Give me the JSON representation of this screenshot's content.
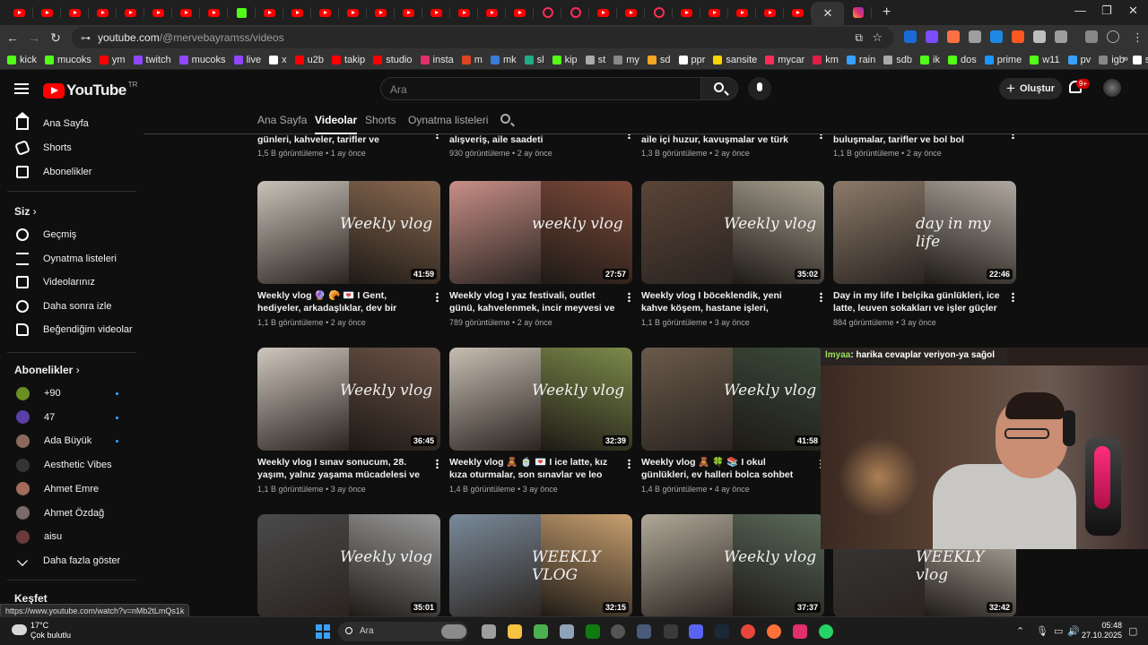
{
  "browser": {
    "url_host": "youtube.com",
    "url_path": "/@mervebayramss/videos",
    "new_tab": "+",
    "window_min": "—",
    "window_max": "❐",
    "window_close": "✕",
    "status_url": "https://www.youtube.com/watch?v=nMb2tLmQs1k",
    "bookmarks": [
      "kick",
      "mucoks",
      "ym",
      "twitch",
      "mucoks",
      "live",
      "x",
      "u2b",
      "takip",
      "studio",
      "insta",
      "m",
      "mk",
      "sl",
      "kip",
      "st",
      "my",
      "sd",
      "ppr",
      "sansite",
      "mycar",
      "km",
      "rain",
      "sdb",
      "ik",
      "dos",
      "prime",
      "w11",
      "pv",
      "igb",
      "steam"
    ],
    "bookmark_colors": [
      "#53fc18",
      "#53fc18",
      "#ff0000",
      "#9146ff",
      "#9146ff",
      "#9146ff",
      "#ffffff",
      "#ff0000",
      "#ff0000",
      "#ff0000",
      "#e1306c",
      "#dd4422",
      "#3a7bd5",
      "#22aa88",
      "#53fc18",
      "#aaaaaa",
      "#888888",
      "#f5a623",
      "#ffffff",
      "#ffd400",
      "#ff2d55",
      "#e11d48",
      "#3aa0ff",
      "#aaaaaa",
      "#53fc18",
      "#53fc18",
      "#1a98ff",
      "#53fc18",
      "#3aa0ff",
      "#888888",
      "#ffffff"
    ],
    "bookmarks_more": "»"
  },
  "header": {
    "logo": "YouTube",
    "region": "TR",
    "search_placeholder": "Ara",
    "create_label": "Oluştur",
    "notif_count": "9+"
  },
  "sidebar": {
    "main": [
      {
        "label": "Ana Sayfa",
        "icon": "home-icon"
      },
      {
        "label": "Shorts",
        "icon": "shorts-icon"
      },
      {
        "label": "Abonelikler",
        "icon": "subscriptions-icon"
      }
    ],
    "you_header": "Siz",
    "you": [
      {
        "label": "Geçmiş",
        "icon": "history-icon"
      },
      {
        "label": "Oynatma listeleri",
        "icon": "playlists-icon"
      },
      {
        "label": "Videolarınız",
        "icon": "your-videos-icon"
      },
      {
        "label": "Daha sonra izle",
        "icon": "watch-later-icon"
      },
      {
        "label": "Beğendiğim videolar",
        "icon": "liked-videos-icon"
      }
    ],
    "subs_header": "Abonelikler",
    "subs": [
      {
        "label": "+90",
        "color": "#6b8e23",
        "dot": true
      },
      {
        "label": "47",
        "color": "#5b3fa8",
        "dot": true
      },
      {
        "label": "Ada Büyük",
        "color": "#8a6a5a",
        "dot": true
      },
      {
        "label": "Aesthetic Vibes",
        "color": "#333333",
        "dot": false
      },
      {
        "label": "Ahmet Emre",
        "color": "#a36b5b",
        "dot": false
      },
      {
        "label": "Ahmet Özdağ",
        "color": "#7a6a6a",
        "dot": false
      },
      {
        "label": "aisu",
        "color": "#6a3a3a",
        "dot": false
      }
    ],
    "show_more": "Daha fazla göster",
    "explore_header": "Keşfet"
  },
  "channel_tabs": [
    "Ana Sayfa",
    "Videolar",
    "Shorts",
    "Oynatma listeleri"
  ],
  "active_tab": "Videolar",
  "videos": [
    {
      "title": "günleri, kahveler, tarifler ve yürüyüşler",
      "meta": "1,5 B görüntüleme • 1 ay önce",
      "partial": true
    },
    {
      "title": "alışveriş, aile saadeti",
      "meta": "930 görüntüleme • 2 ay önce",
      "partial": true
    },
    {
      "title": "aile içi huzur, kavuşmalar ve türk lezzetleri",
      "meta": "1,3 B görüntüleme • 2 ay önce",
      "partial": true
    },
    {
      "title": "buluşmalar, tarifler ve bol bol eğlence",
      "meta": "1,1 B görüntüleme • 2 ay önce",
      "partial": true
    },
    {
      "title": "Weekly vlog 🔮 🥐 💌 I Gent, hediyeler, arkadaşlıklar, dev bir kruvasan ve Leo",
      "meta": "1,1 B görüntüleme • 2 ay önce",
      "duration": "41:59",
      "overlay": "Weekly vlog",
      "colors": [
        "#c9c2b8",
        "#8b6a52"
      ]
    },
    {
      "title": "Weekly vlog I yaz festivali, outlet günü, kahvelenmek, incir meyvesi ve leuven...",
      "meta": "789 görüntüleme • 2 ay önce",
      "duration": "27:57",
      "overlay": "weekly vlog",
      "colors": [
        "#c98f88",
        "#7d4a3a"
      ]
    },
    {
      "title": "Weekly vlog I böceklendik, yeni kahve köşem, hastane işleri, buluşmalar ve fazlası",
      "meta": "1,1 B görüntüleme • 3 ay önce",
      "duration": "35:02",
      "overlay": "Weekly vlog",
      "colors": [
        "#5a4438",
        "#a8a091"
      ]
    },
    {
      "title": "Day in my life I belçika günlükleri, ice latte, leuven sokakları ve işler güçler",
      "meta": "884 görüntüleme • 3 ay önce",
      "duration": "22:46",
      "overlay": "day in my life",
      "colors": [
        "#8b7a6a",
        "#b0a8a0"
      ]
    },
    {
      "title": "Weekly vlog I sınav sonucum, 28. yaşım, yalnız yaşama mücadelesi ve doğru kıvamd...",
      "meta": "1,1 B görüntüleme • 3 ay önce",
      "duration": "36:45",
      "overlay": "Weekly vlog",
      "colors": [
        "#cfc6bd",
        "#6a5246"
      ]
    },
    {
      "title": "Weekly vlog 🧸 🍵 💌 I ice latte, kız kıza oturmalar, son sınavlar ve leo 🐈‍⬛",
      "meta": "1,4 B görüntüleme • 3 ay önce",
      "duration": "32:39",
      "overlay": "Weekly vlog",
      "colors": [
        "#c7bdb2",
        "#7c8a4a"
      ]
    },
    {
      "title": "Weekly vlog 🧸 🍀 📚 I okul günlükleri, ev halleri bolca sohbet",
      "meta": "1,4 B görüntüleme • 4 ay önce",
      "duration": "41:58",
      "overlay": "Weekly vlog",
      "colors": [
        "#6a5a4a",
        "#3a4a3a"
      ]
    },
    {
      "title": "",
      "meta": "",
      "duration": "",
      "overlay": "",
      "colors": [
        "#6a5a4a",
        "#3a4a3a"
      ]
    },
    {
      "title": "",
      "meta": "",
      "duration": "35:01",
      "overlay": "Weekly vlog",
      "colors": [
        "#4a4a4a",
        "#9a9a9a"
      ]
    },
    {
      "title": "",
      "meta": "",
      "duration": "32:15",
      "overlay": "WEEKLY VLOG",
      "colors": [
        "#7a8a9a",
        "#c9a070"
      ]
    },
    {
      "title": "",
      "meta": "",
      "duration": "37:37",
      "overlay": "Weekly vlog",
      "colors": [
        "#b0a898",
        "#5a6a5a"
      ]
    },
    {
      "title": "",
      "meta": "",
      "duration": "32:42",
      "overlay": "WEEKLY vlog",
      "colors": [
        "#3a3a3a",
        "#c9c0b5"
      ]
    }
  ],
  "stream_overlay": {
    "chat_nick": "lmyaa",
    "chat_text": ": harika cevaplar veriyon-ya sağol"
  },
  "taskbar": {
    "temp": "17°C",
    "weather": "Çok bulutlu",
    "search_placeholder": "Ara",
    "time": "05:48",
    "date": "27.10.2025"
  }
}
